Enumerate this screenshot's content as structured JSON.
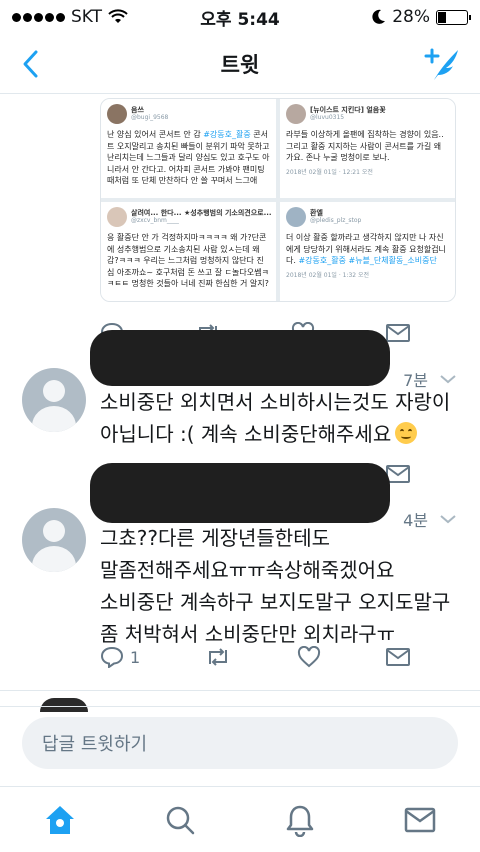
{
  "status_bar": {
    "carrier": "SKT",
    "time": "오후 5:44",
    "battery": "28%",
    "battery_level": 0.28
  },
  "nav": {
    "title": "트윗"
  },
  "embedded_image": {
    "tweets": [
      {
        "name": "음쓰",
        "handle": "@bugi_9568",
        "text_parts": [
          "난 양심 있어서 콘서트 안 감 ",
          "#강동호_활중",
          " 콘서트 오지말리고 송치된 빠들이 분위기 파악 못하고 난리치는데 느그들과 달리 양심도 있고 호구도 아니라서 안 간다고. 어차피 콘서트 가봐야 팬미팅때처럼 또 단체 만찬하다 안 쓸 꾸며서 느그애"
        ]
      },
      {
        "name": "[뉴이스트 지킨다] 얼음꽃",
        "handle": "@luvu0315",
        "text_parts": [
          "라부들 이상하게 올팬에 집착하는 경향이 있음.. 그리고 활중 지지하는 사람이 콘서트를 가길 왜 가요. 존나 누굴 멍청이로 보나.",
          "",
          ""
        ],
        "date": "2018년 02월 01일 · 12:21 오전"
      },
      {
        "name": "살려여... 한다... ★성추행범의 기소의견으로...",
        "handle": "@zxcv_bnm____",
        "text_parts": [
          "응 활중단 안 가 걱정하지마ㅋㅋㅋㅋ 왜 가?단콘에 성추행범으로 기소송치된 사람 있ㅅ는데 왜 감?ㅋㅋㅋ 우리는 느그처럼 멍청하지 않단다 진심 아조까쇼~ 호구처럼 돈 쓰고 잘 ㄷ놀다오쎔ㅋㅋㅌㅌ 멍청한 것들아 너네 진짜 한심한 거 알지?",
          "",
          ""
        ]
      },
      {
        "name": "환엘",
        "handle": "@pledis_plz_stop",
        "text_parts": [
          "더 이상 활중 할까라고 생각하지 않지만 나 자신에게 당당하기 위해서라도 계속 활중 요청할겁니다. ",
          "#강동호_활중 #뉴블_단체활동_소비중단",
          ""
        ],
        "date": "2018년 02월 01일 · 1:32 오전"
      }
    ]
  },
  "tweet1": {
    "timestamp": "7분",
    "text": "소비중단 외치면서 소비하시는것도 자랑이 아닙니다 :( 계속 소비중단해주세요",
    "emoji": "smiling-face"
  },
  "tweet2": {
    "timestamp": "4분",
    "text": "그쵸??다른 게장년들한테도 말좀전해주세요ㅠㅠ속상해죽겠어요 소비중단 계속하구 보지도말구 오지도말구 좀 처박혀서 소비중단만 외치라구ㅠ",
    "reply_count": "1"
  },
  "reply_bar": {
    "placeholder": "답글 트윗하기"
  },
  "colors": {
    "accent": "#1da1f2",
    "muted": "#657786",
    "divider": "#e1e8ed"
  }
}
